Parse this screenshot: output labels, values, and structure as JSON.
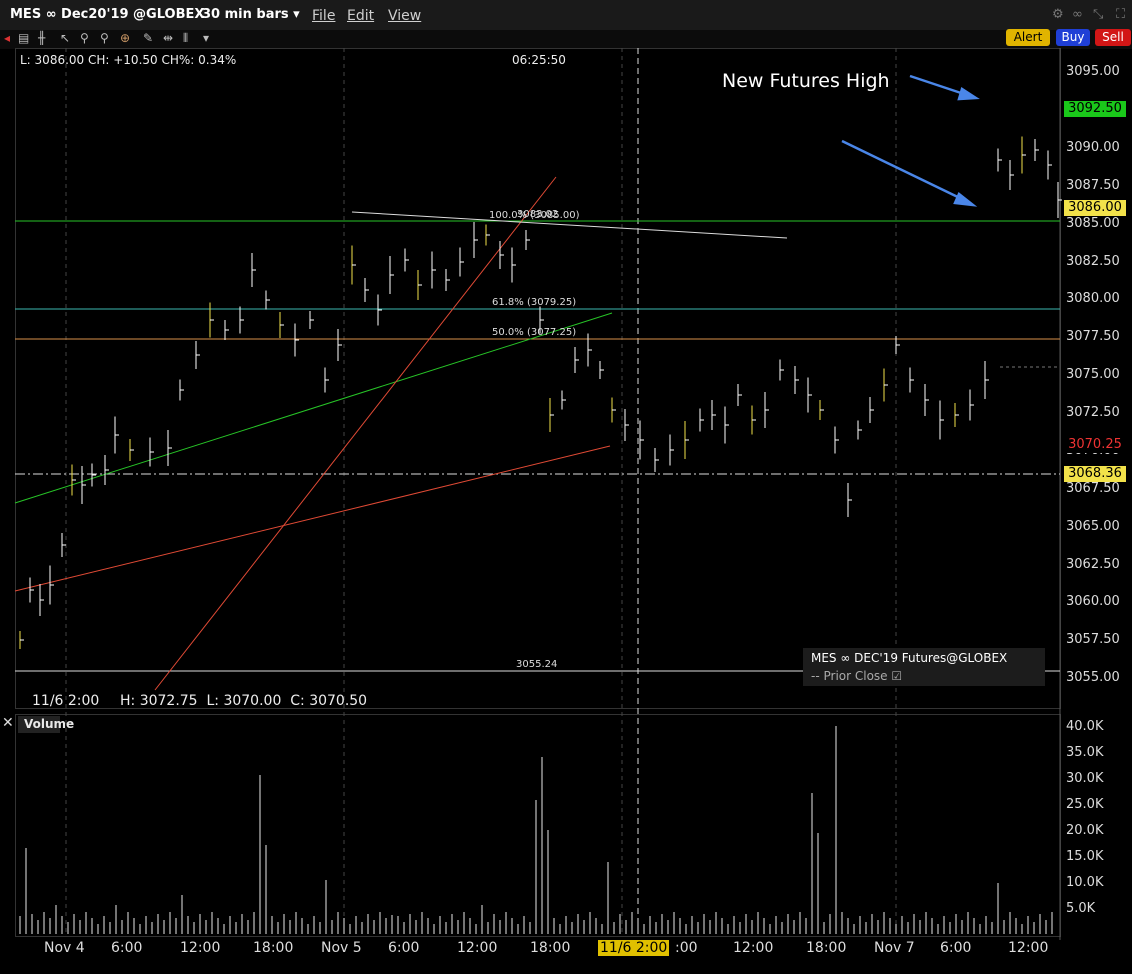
{
  "title": {
    "symbol": "MES ∞ Dec20'19 @GLOBEX",
    "interval": "30 min bars"
  },
  "menu": [
    "File",
    "Edit",
    "View"
  ],
  "toolbar": {
    "alert": "Alert",
    "buy": "Buy",
    "sell": "Sell"
  },
  "info": {
    "last_line": "L: 3086.00 CH: +10.50 CH%: 0.34%",
    "clock": "06:25:50",
    "hover_time": "11/6 2:00",
    "ohlc": "H: 3072.75  L: 3070.00  C: 3070.50"
  },
  "annotation": "New Futures High",
  "fib": {
    "l100": "100.0% (3085.00)",
    "l100b": "3083.02",
    "l618": "61.8% (3079.25)",
    "l50": "50.0% (3077.25)",
    "low_label": "3055.24"
  },
  "price_axis": [
    "3095.00",
    "3090.00",
    "3087.50",
    "3085.00",
    "3082.50",
    "3080.00",
    "3077.50",
    "3075.00",
    "3072.50",
    "3070.00",
    "3067.50",
    "3065.00",
    "3062.50",
    "3060.00",
    "3057.50",
    "3055.00"
  ],
  "price_tags": {
    "high": "3092.50",
    "last": "3086.00",
    "cursor": "3070.25",
    "line": "3068.36"
  },
  "time_axis": [
    "Nov 4",
    "6:00",
    "12:00",
    "18:00",
    "Nov 5",
    "6:00",
    "12:00",
    "18:00",
    "11/6 2:00",
    ":00",
    "12:00",
    "18:00",
    "Nov 7",
    "6:00",
    "12:00"
  ],
  "volume_axis": [
    "40.0K",
    "35.0K",
    "30.0K",
    "25.0K",
    "20.0K",
    "15.0K",
    "10.0K",
    "5.0K"
  ],
  "volume_title": "Volume",
  "legend": {
    "instrument": "MES ∞ DEC'19 Futures@GLOBEX",
    "prior_close": "Prior Close"
  },
  "colors": {
    "up": "#f2e24a",
    "bar": "#ffffff",
    "green": "#27c427",
    "orange": "#ff6a3c",
    "blue_arrow": "#4a86e8",
    "alert": "#e0b400",
    "buy": "#1f3fd6",
    "sell": "#d21616"
  }
}
